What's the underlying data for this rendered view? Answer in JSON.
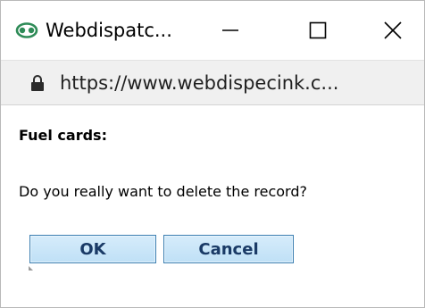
{
  "window": {
    "title": "Webdispatc...",
    "minimize_symbol": "—",
    "maximize_symbol": "☐",
    "close_symbol": "✕"
  },
  "address_bar": {
    "url": "https://www.webdispecink.c..."
  },
  "dialog": {
    "title": "Fuel cards:",
    "message": "Do you really want to delete the record?",
    "ok_label": "OK",
    "cancel_label": "Cancel"
  },
  "icons": {
    "app": "app-logo-icon",
    "lock": "lock-icon"
  },
  "colors": {
    "button_fill": "#cfe8f9",
    "button_border": "#3c7fb1",
    "button_text": "#1a3a66",
    "app_icon": "#2e8b57"
  }
}
